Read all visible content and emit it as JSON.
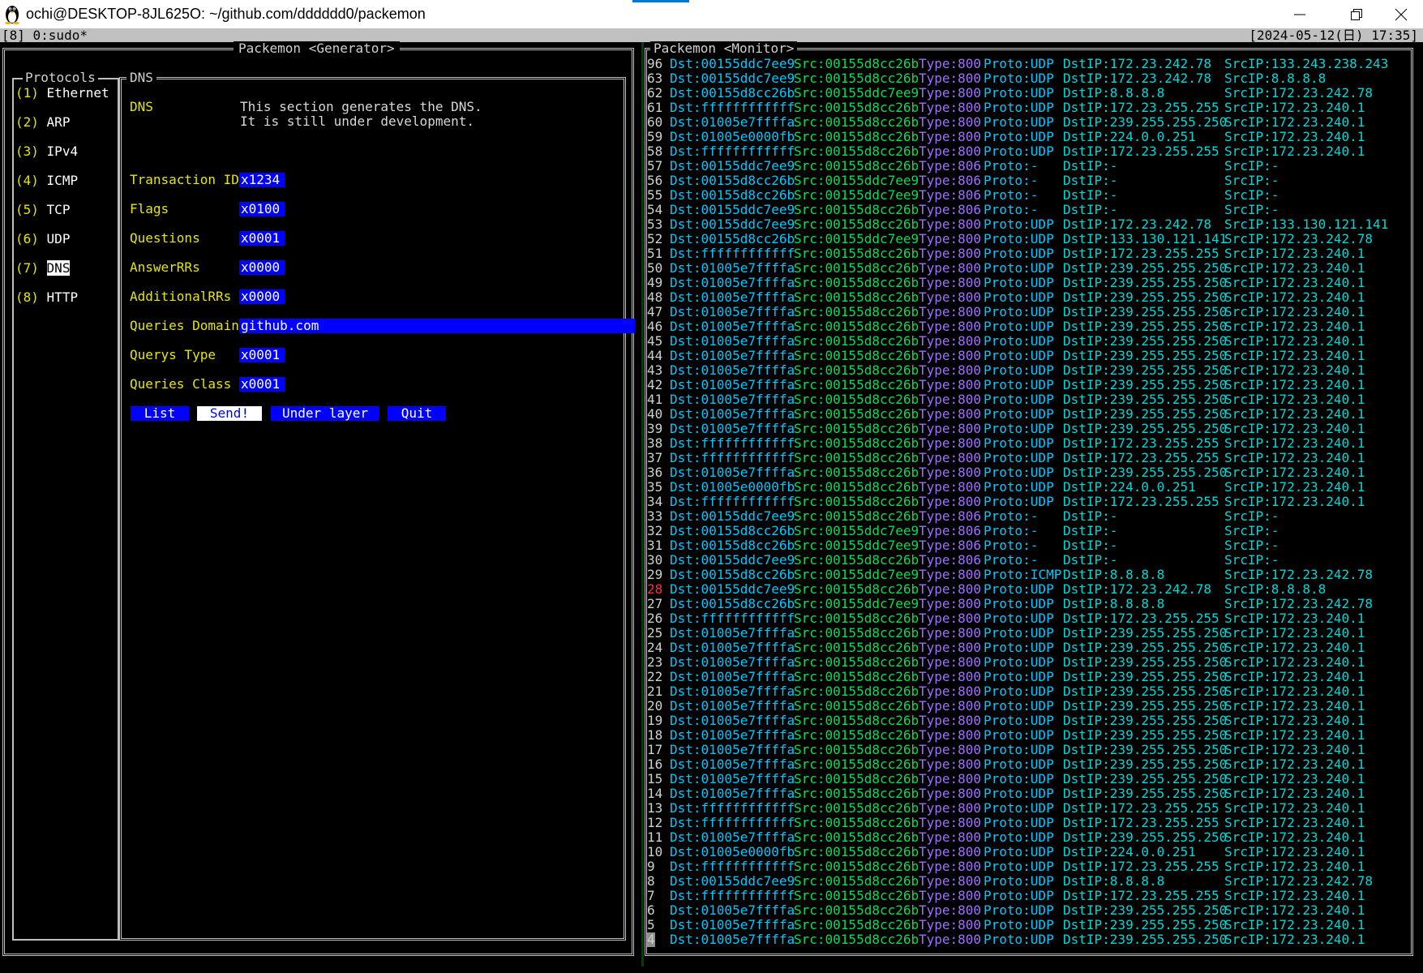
{
  "window": {
    "title": "ochi@DESKTOP-8JL625O: ~/github.com/dddddd0/packemon",
    "accent_color": "#0078d7"
  },
  "tmux": {
    "left": "[8] 0:sudo*",
    "right": "[2024-05-12(日) 17:35]"
  },
  "generator": {
    "title": "Packemon <Generator>",
    "protocols_title": "Protocols",
    "protocols": [
      {
        "key": "(1)",
        "name": "Ethernet",
        "selected": false
      },
      {
        "key": "(2)",
        "name": "ARP",
        "selected": false
      },
      {
        "key": "(3)",
        "name": "IPv4",
        "selected": false
      },
      {
        "key": "(4)",
        "name": "ICMP",
        "selected": false
      },
      {
        "key": "(5)",
        "name": "TCP",
        "selected": false
      },
      {
        "key": "(6)",
        "name": "UDP",
        "selected": false
      },
      {
        "key": "(7)",
        "name": "DNS",
        "selected": true
      },
      {
        "key": "(8)",
        "name": "HTTP",
        "selected": false
      }
    ],
    "form_title": "DNS",
    "section_label": "DNS",
    "description_line1": "This section generates the DNS.",
    "description_line2": "It is still under development.",
    "fields": [
      {
        "label": "Transaction ID",
        "value": "x1234"
      },
      {
        "label": "Flags",
        "value": "x0100"
      },
      {
        "label": "Questions",
        "value": "x0001"
      },
      {
        "label": "AnswerRRs",
        "value": "x0000"
      },
      {
        "label": "AdditionalRRs",
        "value": "x0000"
      },
      {
        "label": "Queries Domain",
        "value": "github.com"
      },
      {
        "label": "Querys Type",
        "value": "x0001"
      },
      {
        "label": "Queries Class",
        "value": "x0001"
      }
    ],
    "buttons": {
      "list": "List",
      "send": "Send!",
      "under_layer": "Under layer",
      "quit": "Quit"
    }
  },
  "monitor": {
    "title": "Packemon <Monitor>",
    "rows": [
      {
        "n": "96",
        "dst": "Dst:00155ddc7ee9",
        "src": "Src:00155d8cc26b",
        "type": "Type:800",
        "proto": "Proto:UDP",
        "dstip": "DstIP:172.23.242.78",
        "srcip": "SrcIP:133.243.238.243"
      },
      {
        "n": "63",
        "dst": "Dst:00155ddc7ee9",
        "src": "Src:00155d8cc26b",
        "type": "Type:800",
        "proto": "Proto:UDP",
        "dstip": "DstIP:172.23.242.78",
        "srcip": "SrcIP:8.8.8.8"
      },
      {
        "n": "62",
        "dst": "Dst:00155d8cc26b",
        "src": "Src:00155ddc7ee9",
        "type": "Type:800",
        "proto": "Proto:UDP",
        "dstip": "DstIP:8.8.8.8",
        "srcip": "SrcIP:172.23.242.78"
      },
      {
        "n": "61",
        "dst": "Dst:ffffffffffff",
        "src": "Src:00155d8cc26b",
        "type": "Type:800",
        "proto": "Proto:UDP",
        "dstip": "DstIP:172.23.255.255",
        "srcip": "SrcIP:172.23.240.1"
      },
      {
        "n": "60",
        "dst": "Dst:01005e7ffffa",
        "src": "Src:00155d8cc26b",
        "type": "Type:800",
        "proto": "Proto:UDP",
        "dstip": "DstIP:239.255.255.250",
        "srcip": "SrcIP:172.23.240.1"
      },
      {
        "n": "59",
        "dst": "Dst:01005e0000fb",
        "src": "Src:00155d8cc26b",
        "type": "Type:800",
        "proto": "Proto:UDP",
        "dstip": "DstIP:224.0.0.251",
        "srcip": "SrcIP:172.23.240.1"
      },
      {
        "n": "58",
        "dst": "Dst:ffffffffffff",
        "src": "Src:00155d8cc26b",
        "type": "Type:800",
        "proto": "Proto:UDP",
        "dstip": "DstIP:172.23.255.255",
        "srcip": "SrcIP:172.23.240.1"
      },
      {
        "n": "57",
        "dst": "Dst:00155ddc7ee9",
        "src": "Src:00155d8cc26b",
        "type": "Type:806",
        "proto": "Proto:-",
        "dstip": "DstIP:-",
        "srcip": "SrcIP:-"
      },
      {
        "n": "56",
        "dst": "Dst:00155d8cc26b",
        "src": "Src:00155ddc7ee9",
        "type": "Type:806",
        "proto": "Proto:-",
        "dstip": "DstIP:-",
        "srcip": "SrcIP:-"
      },
      {
        "n": "55",
        "dst": "Dst:00155d8cc26b",
        "src": "Src:00155ddc7ee9",
        "type": "Type:806",
        "proto": "Proto:-",
        "dstip": "DstIP:-",
        "srcip": "SrcIP:-"
      },
      {
        "n": "54",
        "dst": "Dst:00155ddc7ee9",
        "src": "Src:00155d8cc26b",
        "type": "Type:806",
        "proto": "Proto:-",
        "dstip": "DstIP:-",
        "srcip": "SrcIP:-"
      },
      {
        "n": "53",
        "dst": "Dst:00155ddc7ee9",
        "src": "Src:00155d8cc26b",
        "type": "Type:800",
        "proto": "Proto:UDP",
        "dstip": "DstIP:172.23.242.78",
        "srcip": "SrcIP:133.130.121.141"
      },
      {
        "n": "52",
        "dst": "Dst:00155d8cc26b",
        "src": "Src:00155ddc7ee9",
        "type": "Type:800",
        "proto": "Proto:UDP",
        "dstip": "DstIP:133.130.121.141",
        "srcip": "SrcIP:172.23.242.78"
      },
      {
        "n": "51",
        "dst": "Dst:ffffffffffff",
        "src": "Src:00155d8cc26b",
        "type": "Type:800",
        "proto": "Proto:UDP",
        "dstip": "DstIP:172.23.255.255",
        "srcip": "SrcIP:172.23.240.1"
      },
      {
        "n": "50",
        "dst": "Dst:01005e7ffffa",
        "src": "Src:00155d8cc26b",
        "type": "Type:800",
        "proto": "Proto:UDP",
        "dstip": "DstIP:239.255.255.250",
        "srcip": "SrcIP:172.23.240.1"
      },
      {
        "n": "49",
        "dst": "Dst:01005e7ffffa",
        "src": "Src:00155d8cc26b",
        "type": "Type:800",
        "proto": "Proto:UDP",
        "dstip": "DstIP:239.255.255.250",
        "srcip": "SrcIP:172.23.240.1"
      },
      {
        "n": "48",
        "dst": "Dst:01005e7ffffa",
        "src": "Src:00155d8cc26b",
        "type": "Type:800",
        "proto": "Proto:UDP",
        "dstip": "DstIP:239.255.255.250",
        "srcip": "SrcIP:172.23.240.1"
      },
      {
        "n": "47",
        "dst": "Dst:01005e7ffffa",
        "src": "Src:00155d8cc26b",
        "type": "Type:800",
        "proto": "Proto:UDP",
        "dstip": "DstIP:239.255.255.250",
        "srcip": "SrcIP:172.23.240.1"
      },
      {
        "n": "46",
        "dst": "Dst:01005e7ffffa",
        "src": "Src:00155d8cc26b",
        "type": "Type:800",
        "proto": "Proto:UDP",
        "dstip": "DstIP:239.255.255.250",
        "srcip": "SrcIP:172.23.240.1"
      },
      {
        "n": "45",
        "dst": "Dst:01005e7ffffa",
        "src": "Src:00155d8cc26b",
        "type": "Type:800",
        "proto": "Proto:UDP",
        "dstip": "DstIP:239.255.255.250",
        "srcip": "SrcIP:172.23.240.1"
      },
      {
        "n": "44",
        "dst": "Dst:01005e7ffffa",
        "src": "Src:00155d8cc26b",
        "type": "Type:800",
        "proto": "Proto:UDP",
        "dstip": "DstIP:239.255.255.250",
        "srcip": "SrcIP:172.23.240.1"
      },
      {
        "n": "43",
        "dst": "Dst:01005e7ffffa",
        "src": "Src:00155d8cc26b",
        "type": "Type:800",
        "proto": "Proto:UDP",
        "dstip": "DstIP:239.255.255.250",
        "srcip": "SrcIP:172.23.240.1"
      },
      {
        "n": "42",
        "dst": "Dst:01005e7ffffa",
        "src": "Src:00155d8cc26b",
        "type": "Type:800",
        "proto": "Proto:UDP",
        "dstip": "DstIP:239.255.255.250",
        "srcip": "SrcIP:172.23.240.1"
      },
      {
        "n": "41",
        "dst": "Dst:01005e7ffffa",
        "src": "Src:00155d8cc26b",
        "type": "Type:800",
        "proto": "Proto:UDP",
        "dstip": "DstIP:239.255.255.250",
        "srcip": "SrcIP:172.23.240.1"
      },
      {
        "n": "40",
        "dst": "Dst:01005e7ffffa",
        "src": "Src:00155d8cc26b",
        "type": "Type:800",
        "proto": "Proto:UDP",
        "dstip": "DstIP:239.255.255.250",
        "srcip": "SrcIP:172.23.240.1"
      },
      {
        "n": "39",
        "dst": "Dst:01005e7ffffa",
        "src": "Src:00155d8cc26b",
        "type": "Type:800",
        "proto": "Proto:UDP",
        "dstip": "DstIP:239.255.255.250",
        "srcip": "SrcIP:172.23.240.1"
      },
      {
        "n": "38",
        "dst": "Dst:ffffffffffff",
        "src": "Src:00155d8cc26b",
        "type": "Type:800",
        "proto": "Proto:UDP",
        "dstip": "DstIP:172.23.255.255",
        "srcip": "SrcIP:172.23.240.1"
      },
      {
        "n": "37",
        "dst": "Dst:ffffffffffff",
        "src": "Src:00155d8cc26b",
        "type": "Type:800",
        "proto": "Proto:UDP",
        "dstip": "DstIP:172.23.255.255",
        "srcip": "SrcIP:172.23.240.1"
      },
      {
        "n": "36",
        "dst": "Dst:01005e7ffffa",
        "src": "Src:00155d8cc26b",
        "type": "Type:800",
        "proto": "Proto:UDP",
        "dstip": "DstIP:239.255.255.250",
        "srcip": "SrcIP:172.23.240.1"
      },
      {
        "n": "35",
        "dst": "Dst:01005e0000fb",
        "src": "Src:00155d8cc26b",
        "type": "Type:800",
        "proto": "Proto:UDP",
        "dstip": "DstIP:224.0.0.251",
        "srcip": "SrcIP:172.23.240.1"
      },
      {
        "n": "34",
        "dst": "Dst:ffffffffffff",
        "src": "Src:00155d8cc26b",
        "type": "Type:800",
        "proto": "Proto:UDP",
        "dstip": "DstIP:172.23.255.255",
        "srcip": "SrcIP:172.23.240.1"
      },
      {
        "n": "33",
        "dst": "Dst:00155ddc7ee9",
        "src": "Src:00155d8cc26b",
        "type": "Type:806",
        "proto": "Proto:-",
        "dstip": "DstIP:-",
        "srcip": "SrcIP:-"
      },
      {
        "n": "32",
        "dst": "Dst:00155d8cc26b",
        "src": "Src:00155ddc7ee9",
        "type": "Type:806",
        "proto": "Proto:-",
        "dstip": "DstIP:-",
        "srcip": "SrcIP:-"
      },
      {
        "n": "31",
        "dst": "Dst:00155d8cc26b",
        "src": "Src:00155ddc7ee9",
        "type": "Type:806",
        "proto": "Proto:-",
        "dstip": "DstIP:-",
        "srcip": "SrcIP:-"
      },
      {
        "n": "30",
        "dst": "Dst:00155ddc7ee9",
        "src": "Src:00155d8cc26b",
        "type": "Type:806",
        "proto": "Proto:-",
        "dstip": "DstIP:-",
        "srcip": "SrcIP:-"
      },
      {
        "n": "29",
        "dst": "Dst:00155d8cc26b",
        "src": "Src:00155ddc7ee9",
        "type": "Type:800",
        "proto": "Proto:ICMP",
        "dstip": "DstIP:8.8.8.8",
        "srcip": "SrcIP:172.23.242.78"
      },
      {
        "n": "28",
        "dst": "Dst:00155ddc7ee9",
        "src": "Src:00155d8cc26b",
        "type": "Type:800",
        "proto": "Proto:UDP",
        "dstip": "DstIP:172.23.242.78",
        "srcip": "SrcIP:8.8.8.8",
        "hot": true
      },
      {
        "n": "27",
        "dst": "Dst:00155d8cc26b",
        "src": "Src:00155ddc7ee9",
        "type": "Type:800",
        "proto": "Proto:UDP",
        "dstip": "DstIP:8.8.8.8",
        "srcip": "SrcIP:172.23.242.78"
      },
      {
        "n": "26",
        "dst": "Dst:ffffffffffff",
        "src": "Src:00155d8cc26b",
        "type": "Type:800",
        "proto": "Proto:UDP",
        "dstip": "DstIP:172.23.255.255",
        "srcip": "SrcIP:172.23.240.1"
      },
      {
        "n": "25",
        "dst": "Dst:01005e7ffffa",
        "src": "Src:00155d8cc26b",
        "type": "Type:800",
        "proto": "Proto:UDP",
        "dstip": "DstIP:239.255.255.250",
        "srcip": "SrcIP:172.23.240.1"
      },
      {
        "n": "24",
        "dst": "Dst:01005e7ffffa",
        "src": "Src:00155d8cc26b",
        "type": "Type:800",
        "proto": "Proto:UDP",
        "dstip": "DstIP:239.255.255.250",
        "srcip": "SrcIP:172.23.240.1"
      },
      {
        "n": "23",
        "dst": "Dst:01005e7ffffa",
        "src": "Src:00155d8cc26b",
        "type": "Type:800",
        "proto": "Proto:UDP",
        "dstip": "DstIP:239.255.255.250",
        "srcip": "SrcIP:172.23.240.1"
      },
      {
        "n": "22",
        "dst": "Dst:01005e7ffffa",
        "src": "Src:00155d8cc26b",
        "type": "Type:800",
        "proto": "Proto:UDP",
        "dstip": "DstIP:239.255.255.250",
        "srcip": "SrcIP:172.23.240.1"
      },
      {
        "n": "21",
        "dst": "Dst:01005e7ffffa",
        "src": "Src:00155d8cc26b",
        "type": "Type:800",
        "proto": "Proto:UDP",
        "dstip": "DstIP:239.255.255.250",
        "srcip": "SrcIP:172.23.240.1"
      },
      {
        "n": "20",
        "dst": "Dst:01005e7ffffa",
        "src": "Src:00155d8cc26b",
        "type": "Type:800",
        "proto": "Proto:UDP",
        "dstip": "DstIP:239.255.255.250",
        "srcip": "SrcIP:172.23.240.1"
      },
      {
        "n": "19",
        "dst": "Dst:01005e7ffffa",
        "src": "Src:00155d8cc26b",
        "type": "Type:800",
        "proto": "Proto:UDP",
        "dstip": "DstIP:239.255.255.250",
        "srcip": "SrcIP:172.23.240.1"
      },
      {
        "n": "18",
        "dst": "Dst:01005e7ffffa",
        "src": "Src:00155d8cc26b",
        "type": "Type:800",
        "proto": "Proto:UDP",
        "dstip": "DstIP:239.255.255.250",
        "srcip": "SrcIP:172.23.240.1"
      },
      {
        "n": "17",
        "dst": "Dst:01005e7ffffa",
        "src": "Src:00155d8cc26b",
        "type": "Type:800",
        "proto": "Proto:UDP",
        "dstip": "DstIP:239.255.255.250",
        "srcip": "SrcIP:172.23.240.1"
      },
      {
        "n": "16",
        "dst": "Dst:01005e7ffffa",
        "src": "Src:00155d8cc26b",
        "type": "Type:800",
        "proto": "Proto:UDP",
        "dstip": "DstIP:239.255.255.250",
        "srcip": "SrcIP:172.23.240.1"
      },
      {
        "n": "15",
        "dst": "Dst:01005e7ffffa",
        "src": "Src:00155d8cc26b",
        "type": "Type:800",
        "proto": "Proto:UDP",
        "dstip": "DstIP:239.255.255.250",
        "srcip": "SrcIP:172.23.240.1"
      },
      {
        "n": "14",
        "dst": "Dst:01005e7ffffa",
        "src": "Src:00155d8cc26b",
        "type": "Type:800",
        "proto": "Proto:UDP",
        "dstip": "DstIP:239.255.255.250",
        "srcip": "SrcIP:172.23.240.1"
      },
      {
        "n": "13",
        "dst": "Dst:ffffffffffff",
        "src": "Src:00155d8cc26b",
        "type": "Type:800",
        "proto": "Proto:UDP",
        "dstip": "DstIP:172.23.255.255",
        "srcip": "SrcIP:172.23.240.1"
      },
      {
        "n": "12",
        "dst": "Dst:ffffffffffff",
        "src": "Src:00155d8cc26b",
        "type": "Type:800",
        "proto": "Proto:UDP",
        "dstip": "DstIP:172.23.255.255",
        "srcip": "SrcIP:172.23.240.1"
      },
      {
        "n": "11",
        "dst": "Dst:01005e7ffffa",
        "src": "Src:00155d8cc26b",
        "type": "Type:800",
        "proto": "Proto:UDP",
        "dstip": "DstIP:239.255.255.250",
        "srcip": "SrcIP:172.23.240.1"
      },
      {
        "n": "10",
        "dst": "Dst:01005e0000fb",
        "src": "Src:00155d8cc26b",
        "type": "Type:800",
        "proto": "Proto:UDP",
        "dstip": "DstIP:224.0.0.251",
        "srcip": "SrcIP:172.23.240.1"
      },
      {
        "n": "9",
        "dst": "Dst:ffffffffffff",
        "src": "Src:00155d8cc26b",
        "type": "Type:800",
        "proto": "Proto:UDP",
        "dstip": "DstIP:172.23.255.255",
        "srcip": "SrcIP:172.23.240.1"
      },
      {
        "n": "8",
        "dst": "Dst:00155ddc7ee9",
        "src": "Src:00155d8cc26b",
        "type": "Type:800",
        "proto": "Proto:UDP",
        "dstip": "DstIP:8.8.8.8",
        "srcip": "SrcIP:172.23.242.78"
      },
      {
        "n": "7",
        "dst": "Dst:ffffffffffff",
        "src": "Src:00155d8cc26b",
        "type": "Type:800",
        "proto": "Proto:UDP",
        "dstip": "DstIP:172.23.255.255",
        "srcip": "SrcIP:172.23.240.1"
      },
      {
        "n": "6",
        "dst": "Dst:01005e7ffffa",
        "src": "Src:00155d8cc26b",
        "type": "Type:800",
        "proto": "Proto:UDP",
        "dstip": "DstIP:239.255.255.250",
        "srcip": "SrcIP:172.23.240.1"
      },
      {
        "n": "5",
        "dst": "Dst:01005e7ffffa",
        "src": "Src:00155d8cc26b",
        "type": "Type:800",
        "proto": "Proto:UDP",
        "dstip": "DstIP:239.255.255.250",
        "srcip": "SrcIP:172.23.240.1"
      },
      {
        "n": "4",
        "dst": "Dst:01005e7ffffa",
        "src": "Src:00155d8cc26b",
        "type": "Type:800",
        "proto": "Proto:UDP",
        "dstip": "DstIP:239.255.255.250",
        "srcip": "SrcIP:172.23.240.1",
        "cursor": true
      }
    ]
  }
}
